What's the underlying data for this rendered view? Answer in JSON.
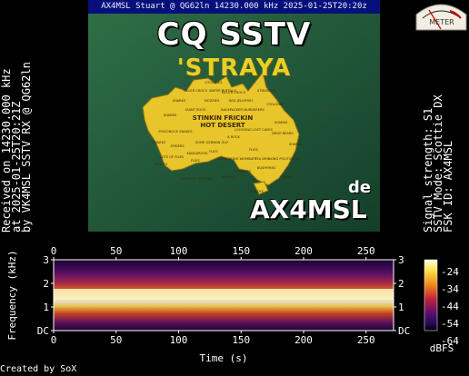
{
  "sstv": {
    "header": "AX4MSL Stuart @ QG62ln    14230.000 kHz 2025-01-25T20:20z",
    "cq": "CQ SSTV",
    "straya": "'STRAYA",
    "map_labels": [
      "CYCLONES",
      "KILLER CROCS",
      "WATER BUFFALO",
      "KILLER CROCS",
      "STINGRAYS",
      "SHARKS",
      "MOZZIES",
      "BOX JELLYFISH",
      "CYCLONES",
      "GIANT ROOS",
      "BACKPACKER MURDERERS",
      "SHARKS",
      "STINKIN FRICKIN",
      "HOT DESERT",
      "POISONOUS SNAKES",
      "LOOOONG LOST CAVES",
      "SHARKS",
      "SHARKS",
      "SOME GERMAN GUY",
      "A ROCK",
      "DROP BEARS",
      "SPIDERS",
      "FLIES",
      "KANGAROOS",
      "FLIES",
      "LOTS OF FLIES",
      "MAN-EATING WOMBATS",
      "TEA DRINKING POLITICIANS",
      "SHARKS",
      "SHARKS",
      "FLIES",
      "BUSHFIRES",
      "STINGING JELLYFISH",
      "SHARKS",
      "CONVICTS",
      "SHARKS",
      "THE BOYS"
    ],
    "de": "de",
    "callsign": "AX4MSL"
  },
  "meter_label": "METER",
  "left_info": [
    "Received on  14230.000 kHz",
    "at 2025-01-25T20:21Z",
    "by VK4MSL SSTV RX @ QG62ln"
  ],
  "right_info": [
    "Signal strength: S1",
    "SSTV Mode: Scottie DX",
    "FSK ID: AX4MSL"
  ],
  "spectrogram": {
    "x_axis_title": "Time (s)",
    "y_axis_title": "Frequency (kHz)",
    "x_ticks": [
      "0",
      "50",
      "100",
      "150",
      "200",
      "250"
    ],
    "x_tick_values": [
      0,
      50,
      100,
      150,
      200,
      250
    ],
    "x_range": [
      0,
      272
    ],
    "y_ticks_left": [
      "3",
      "2",
      "1",
      "DC"
    ],
    "y_ticks_right": [
      "3",
      "2",
      "1",
      "DC"
    ],
    "y_tick_values": [
      3,
      2,
      1,
      0
    ],
    "colorbar_ticks": [
      "-24",
      "-34",
      "-44",
      "-54",
      "-64"
    ],
    "colorbar_unit": "dBFS"
  },
  "credit": "Created by SoX"
}
